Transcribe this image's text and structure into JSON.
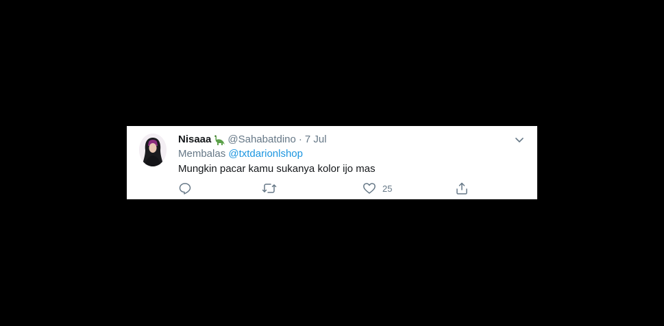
{
  "tweet": {
    "display_name": "Nisaaa",
    "name_emoji": "sauropod-emoji",
    "handle": "@Sahabatdino",
    "separator": "·",
    "date": "7 Jul",
    "reply_prefix": "Membalas",
    "reply_to": "@txtdarionlshop",
    "text": "Mungkin pacar kamu sukanya kolor ijo mas",
    "likes": "25"
  },
  "icons": {
    "reply": "reply-icon",
    "retweet": "retweet-icon",
    "like": "heart-icon",
    "share": "share-icon",
    "menu": "chevron-down-icon"
  },
  "colors": {
    "background": "#000000",
    "card": "#ffffff",
    "text": "#14171a",
    "muted": "#657786",
    "link": "#1b95e0"
  }
}
